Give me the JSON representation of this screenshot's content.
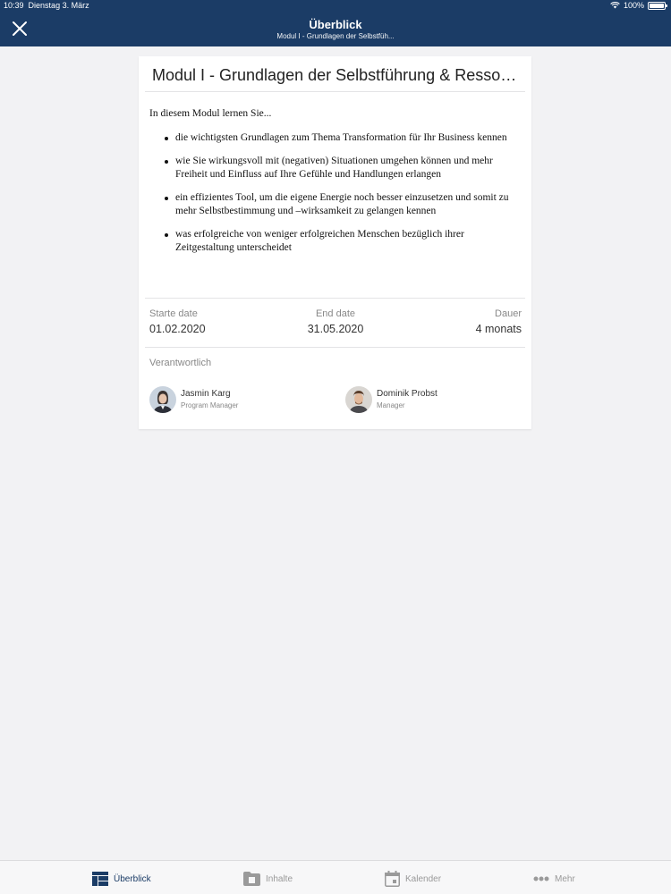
{
  "status_bar": {
    "time": "10:39",
    "date": "Dienstag 3. März",
    "battery": "100%"
  },
  "header": {
    "title": "Überblick",
    "subtitle": "Modul I - Grundlagen der Selbstfüh...",
    "close_icon": "close-icon"
  },
  "module": {
    "title": "Modul I - Grundlagen der Selbstführung & Ressource...",
    "intro": "In diesem Modul lernen Sie...",
    "bullets": [
      "die wichtigsten Grundlagen zum Thema Transformation für Ihr Business kennen",
      "wie Sie wirkungsvoll mit (negativen) Situationen umgehen können und mehr Freiheit und Einfluss auf Ihre Gefühle und Handlungen erlangen",
      "ein effizientes Tool, um die eigene Energie noch besser einzusetzen und somit zu mehr Selbstbestimmung und –wirksamkeit zu gelangen kennen",
      "was erfolgreiche von weniger erfolgreichen Menschen bezüglich ihrer Zeitgestaltung unterscheidet"
    ],
    "start": {
      "label": "Starte date",
      "value": "01.02.2020"
    },
    "end": {
      "label": "End date",
      "value": "31.05.2020"
    },
    "duration": {
      "label": "Dauer",
      "value": "4 monats"
    },
    "responsible_label": "Verantwortlich",
    "people": [
      {
        "name": "Jasmin Karg",
        "role": "Program Manager"
      },
      {
        "name": "Dominik Probst",
        "role": "Manager"
      }
    ]
  },
  "tabs": [
    {
      "label": "Überblick",
      "icon": "dashboard-icon",
      "active": true
    },
    {
      "label": "Inhalte",
      "icon": "folder-icon",
      "active": false
    },
    {
      "label": "Kalender",
      "icon": "calendar-icon",
      "active": false
    },
    {
      "label": "Mehr",
      "icon": "more-dots-icon",
      "active": false
    }
  ],
  "colors": {
    "header": "#1b3c66",
    "active_tab": "#1b3c66",
    "inactive_tab": "#999999"
  }
}
